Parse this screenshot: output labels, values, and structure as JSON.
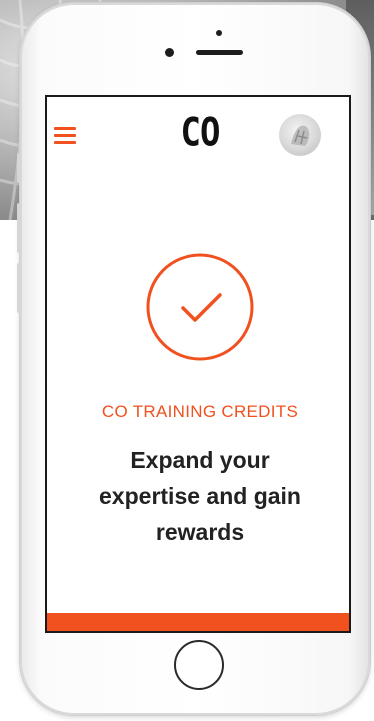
{
  "app": {
    "logo_text": "CO"
  },
  "hero": {
    "credits_title": "CO TRAINING CREDITS",
    "headline_line1": "Expand your",
    "headline_line2": "expertise and gain",
    "headline_line3": "rewards"
  },
  "icons": {
    "menu": "hamburger-menu-icon",
    "avatar": "user-avatar",
    "success": "checkmark-circle-icon",
    "home": "home-button"
  },
  "colors": {
    "accent": "#f1511f",
    "text_dark": "#222222",
    "logo": "#111111"
  }
}
